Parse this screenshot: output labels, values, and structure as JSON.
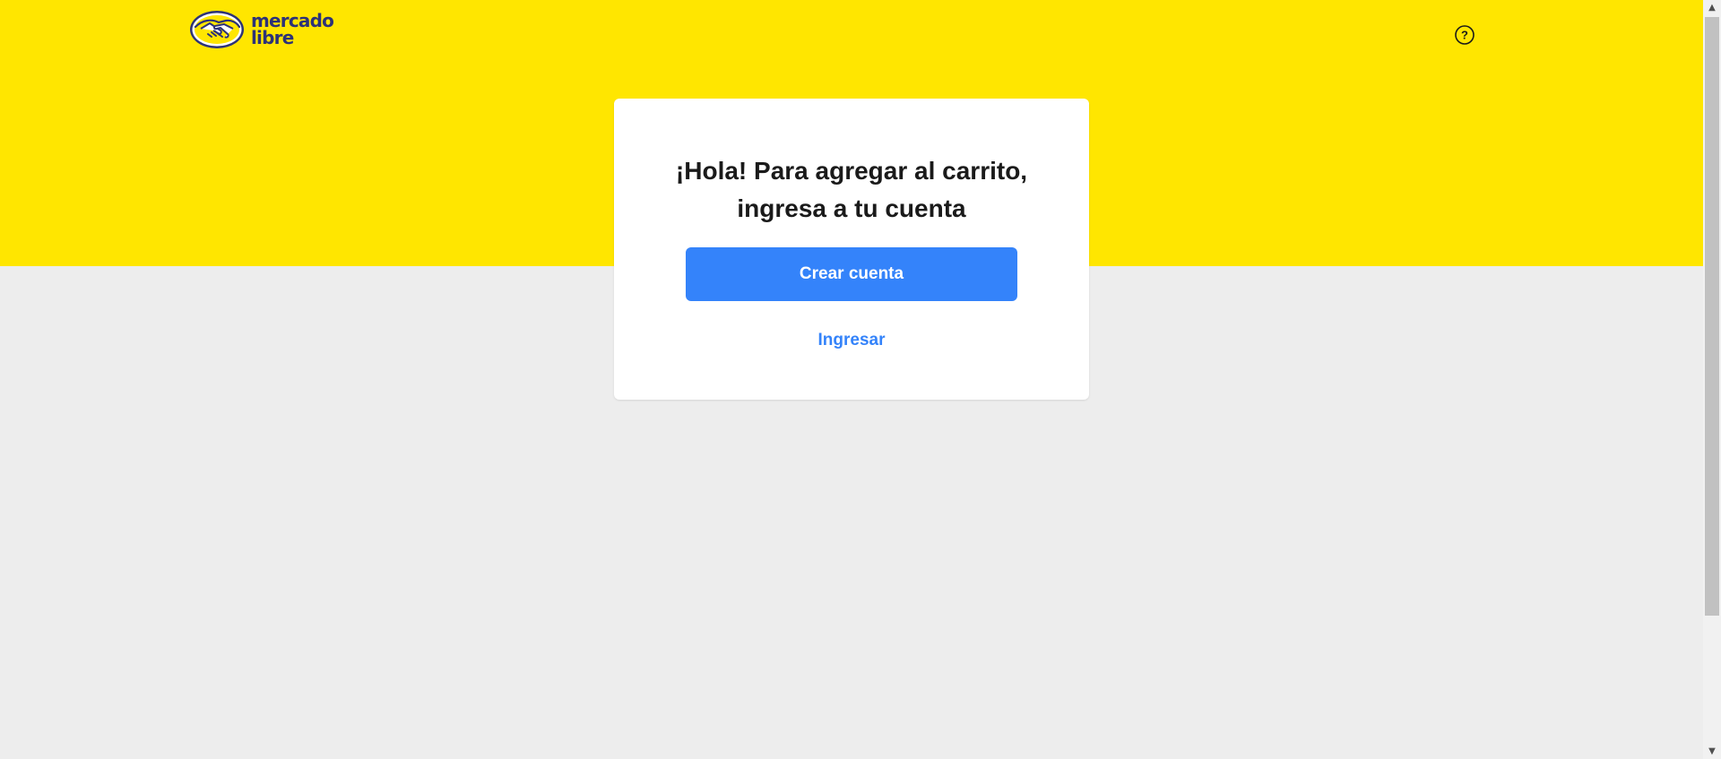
{
  "header": {
    "logo": {
      "line1": "mercado",
      "line2": "libre",
      "icon": "handshake-logo-icon"
    },
    "help_icon": "question-circle-icon",
    "help_symbol": "?"
  },
  "card": {
    "title": "¡Hola! Para agregar al carrito, ingresa a tu cuenta",
    "create_account_label": "Crear cuenta",
    "login_label": "Ingresar"
  },
  "scrollbar": {
    "up_arrow": "▲",
    "down_arrow": "▼"
  },
  "colors": {
    "brand_yellow": "#ffe600",
    "brand_blue": "#3483fa",
    "logo_navy": "#2d3277",
    "background_gray": "#ededed"
  }
}
